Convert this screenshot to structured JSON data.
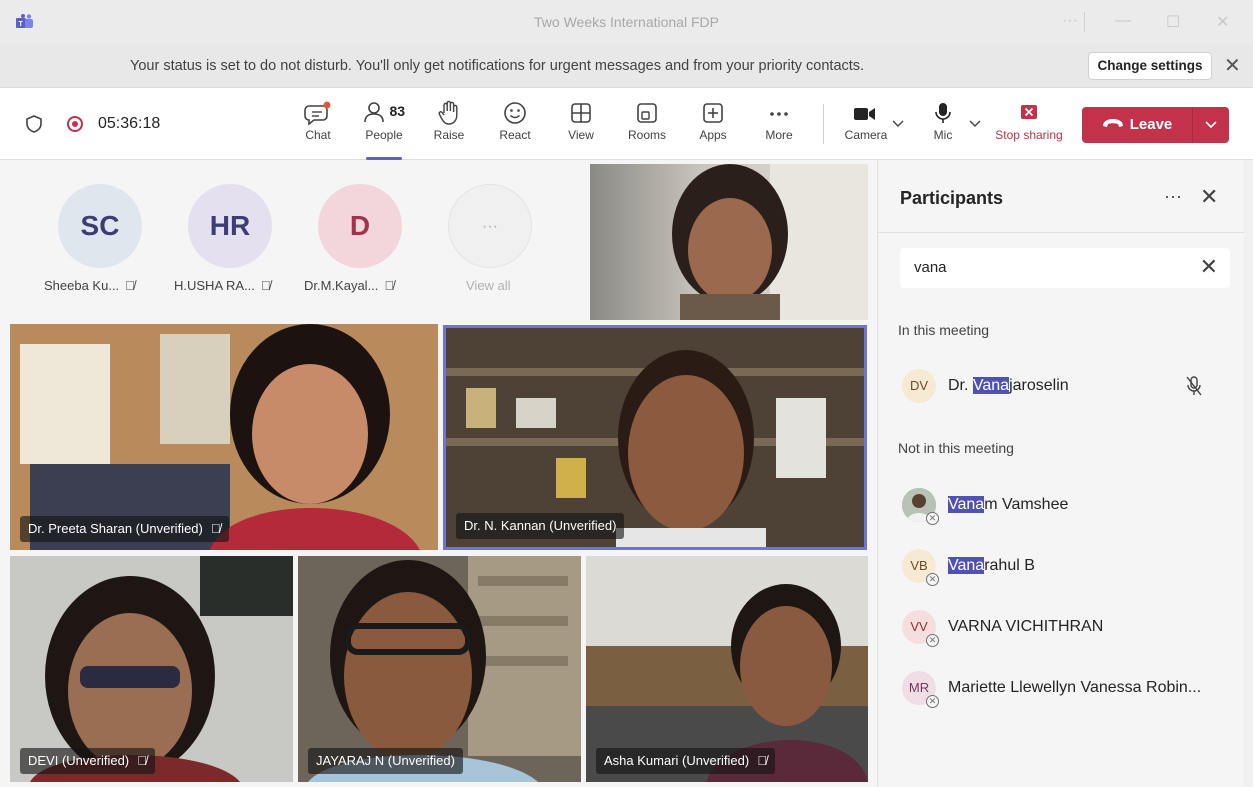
{
  "window": {
    "title": "Two Weeks International FDP",
    "controls": [
      "···",
      "—",
      "☐",
      "✕"
    ]
  },
  "banner": {
    "message": "Your status is set to do not disturb. You'll only get notifications for urgent messages and from your priority contacts.",
    "change_settings": "Change settings",
    "close": "✕"
  },
  "toolbar": {
    "timer": "05:36:18",
    "people_count": "83",
    "buttons": {
      "chat": "Chat",
      "people": "People",
      "raise": "Raise",
      "react": "React",
      "view": "View",
      "rooms": "Rooms",
      "apps": "Apps",
      "more": "More",
      "camera": "Camera",
      "mic": "Mic",
      "stop_sharing": "Stop sharing"
    },
    "leave": "Leave"
  },
  "avatars": [
    {
      "initials": "SC",
      "label": "Sheeba Ku...",
      "bg": "#dfe6ee"
    },
    {
      "initials": "HR",
      "label": "H.USHA RA...",
      "bg": "#e4e0f0"
    },
    {
      "initials": "D",
      "label": "Dr.M.Kayal...",
      "bg": "#f3d6dc"
    },
    {
      "initials": "···",
      "label": "View all",
      "bg": "#f0f0f0"
    }
  ],
  "tiles": {
    "preeta": "Dr. Preeta Sharan (Unverified)",
    "kannan": "Dr. N. Kannan (Unverified)",
    "devi": "DEVI (Unverified)",
    "jayaraj": "JAYARAJ N (Unverified)",
    "asha": "Asha Kumari (Unverified)"
  },
  "panel": {
    "title": "Participants",
    "more": "···",
    "close": "✕",
    "search_value": "vana",
    "search_clear": "✕",
    "in_meeting_label": "In this meeting",
    "not_in_meeting_label": "Not in this meeting",
    "in_meeting": [
      {
        "initials": "DV",
        "prefix": "Dr. ",
        "match": "Vana",
        "suffix": "jaroselin",
        "bg": "#f6ead3"
      }
    ],
    "not_in_meeting": [
      {
        "initials": "",
        "match": "Vana",
        "suffix": "m Vamshee",
        "bg": "#9aa59a"
      },
      {
        "initials": "VB",
        "match": "Vana",
        "suffix": "rahul B",
        "bg": "#f6ead3"
      },
      {
        "initials": "VV",
        "match": "",
        "suffix": "VARNA VICHITHRAN",
        "bg": "#f7dede"
      },
      {
        "initials": "MR",
        "match": "",
        "suffix": "Mariette Llewellyn Vanessa Robin...",
        "bg": "#f0dde6"
      }
    ]
  },
  "colors": {
    "accent": "#5b5fc7",
    "leave": "#c4314b",
    "highlight": "#4f52b2"
  }
}
